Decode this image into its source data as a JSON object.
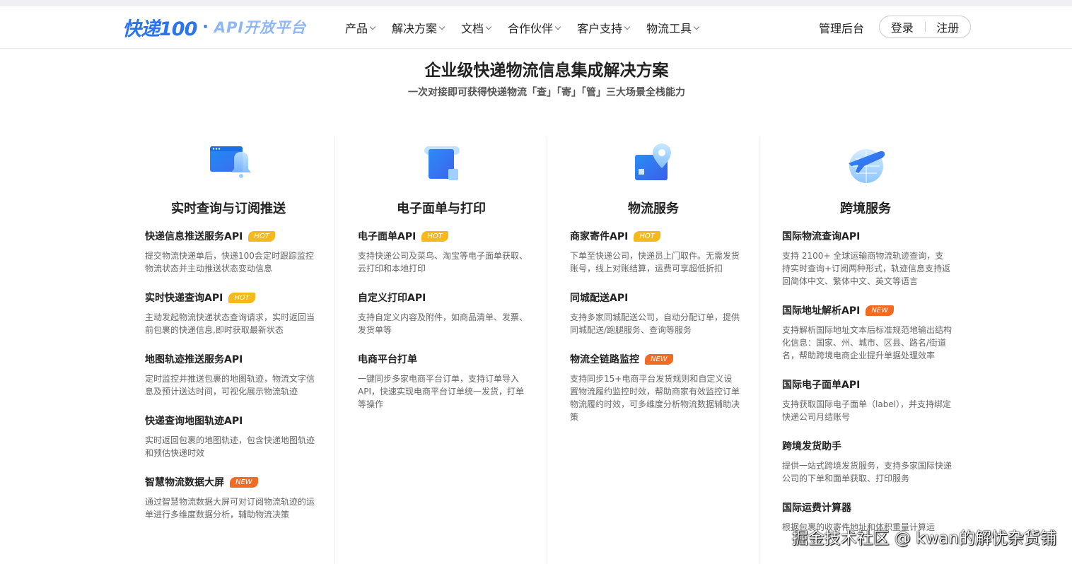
{
  "header": {
    "logo_main": "快递100",
    "logo_dot": "·",
    "logo_sub": "API开放平台",
    "nav": [
      "产品",
      "解决方案",
      "文档",
      "合作伙伴",
      "客户支持",
      "物流工具"
    ],
    "admin": "管理后台",
    "login": "登录",
    "register": "注册"
  },
  "hero": {
    "title": "企业级快递物流信息集成解决方案",
    "subtitle": "一次对接即可获得快递物流「查」「寄」「管」三大场景全栈能力"
  },
  "columns": [
    {
      "title": "实时查询与订阅推送",
      "icon": "bell-window-icon",
      "items": [
        {
          "title": "快递信息推送服务API",
          "badge": "HOT",
          "desc": "提交物流快递单后，快递100会定时跟踪监控物流状态并主动推送状态变动信息"
        },
        {
          "title": "实时快递查询API",
          "badge": "HOT",
          "desc": "主动发起物流快递状态查询请求，实时返回当前包裹的快递信息,即时获取最新状态"
        },
        {
          "title": "地图轨迹推送服务API",
          "badge": "",
          "desc": "定时监控并推送包裹的地图轨迹，物流文字信息及预计送达时间，可视化展示物流轨迹"
        },
        {
          "title": "快递查询地图轨迹API",
          "badge": "",
          "desc": "实时返回包裹的地图轨迹，包含快递地图轨迹和预估快递时效"
        },
        {
          "title": "智慧物流数据大屏",
          "badge": "NEW",
          "desc": "通过智慧物流数据大屏可对订阅物流轨迹的运单进行多维度数据分析，辅助物流决策"
        }
      ]
    },
    {
      "title": "电子面单与打印",
      "icon": "document-scroll-icon",
      "items": [
        {
          "title": "电子面单API",
          "badge": "HOT",
          "desc": "支持快递公司及菜鸟、淘宝等电子面单获取、云打印和本地打印"
        },
        {
          "title": "自定义打印API",
          "badge": "",
          "desc": "支持自定义内容及附件，如商品清单、发票、发货单等"
        },
        {
          "title": "电商平台打单",
          "badge": "",
          "desc": "一键同步多家电商平台订单，支持订单导入API，快速实现电商平台订单统一发货，打单等操作"
        }
      ]
    },
    {
      "title": "物流服务",
      "icon": "map-pin-icon",
      "items": [
        {
          "title": "商家寄件API",
          "badge": "HOT",
          "desc": "下单至快递公司，快递员上门取件。无需发货账号，线上对账结算，运费可享超低折扣"
        },
        {
          "title": "同城配送API",
          "badge": "",
          "desc": "支持多家同城配送公司，自动分配订单，提供同城配送/跑腿服务、查询等服务"
        },
        {
          "title": "物流全链路监控",
          "badge": "NEW",
          "desc": "支持同步15+电商平台发货规则和自定义设置物流履约监控时效，帮助商家有效监控订单物流履约时效，可多维度分析物流数据辅助决策"
        }
      ]
    },
    {
      "title": "跨境服务",
      "icon": "airplane-globe-icon",
      "items": [
        {
          "title": "国际物流查询API",
          "badge": "",
          "desc": "支持 2100+ 全球运输商物流轨迹查询，支持实时查询+订阅两种形式，轨迹信息支持返回简体中文、繁体中文、英文等语言"
        },
        {
          "title": "国际地址解析API",
          "badge": "NEW",
          "desc": "支持解析国际地址文本后标准规范地输出结构化信息：国家、州、城市、区县、路名/街道名，帮助跨境电商企业提升单据处理效率"
        },
        {
          "title": "国际电子面单API",
          "badge": "",
          "desc": "支持获取国际电子面单（label），并支持绑定快递公司月结账号"
        },
        {
          "title": "跨境发货助手",
          "badge": "",
          "desc": "提供一站式跨境发货服务，支持多家国际快递公司的下单和面单获取、打印服务"
        },
        {
          "title": "国际运费计算器",
          "badge": "",
          "desc": "根据包裹的收寄件地址和体积重量计算运"
        }
      ]
    }
  ],
  "watermark": "掘金技术社区 @ kwan的解忧杂货铺"
}
